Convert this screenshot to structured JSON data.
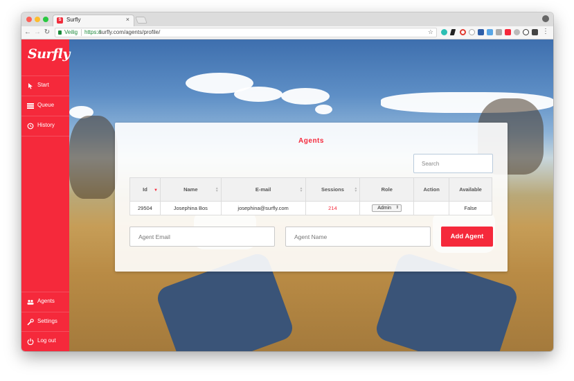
{
  "browser": {
    "tab_title": "Surfly",
    "tab_close": "×",
    "secure_label": "Veilig",
    "url_scheme": "https://",
    "url_rest": "surfly.com/agents/profile/"
  },
  "sidebar": {
    "logo": "Surfly",
    "items": [
      {
        "label": "Start",
        "icon": "cursor-icon"
      },
      {
        "label": "Queue",
        "icon": "queue-icon"
      },
      {
        "label": "History",
        "icon": "history-icon"
      }
    ],
    "bottom_items": [
      {
        "label": "Agents",
        "icon": "users-icon"
      },
      {
        "label": "Settings",
        "icon": "wrench-icon"
      },
      {
        "label": "Log out",
        "icon": "power-icon"
      }
    ]
  },
  "panel": {
    "title": "Agents",
    "search_placeholder": "Search",
    "columns": [
      "Id",
      "Name",
      "E-mail",
      "Sessions",
      "Role",
      "Action",
      "Available"
    ],
    "rows": [
      {
        "id": "29504",
        "name": "Josephina Bos",
        "email": "josephina@surfly.com",
        "sessions": "214",
        "role": "Admin",
        "action": "",
        "available": "False"
      }
    ],
    "agent_email_placeholder": "Agent Email",
    "agent_name_placeholder": "Agent Name",
    "add_button": "Add Agent"
  },
  "colors": {
    "brand_red": "#f5293b",
    "secure_green": "#1b8a3a"
  }
}
